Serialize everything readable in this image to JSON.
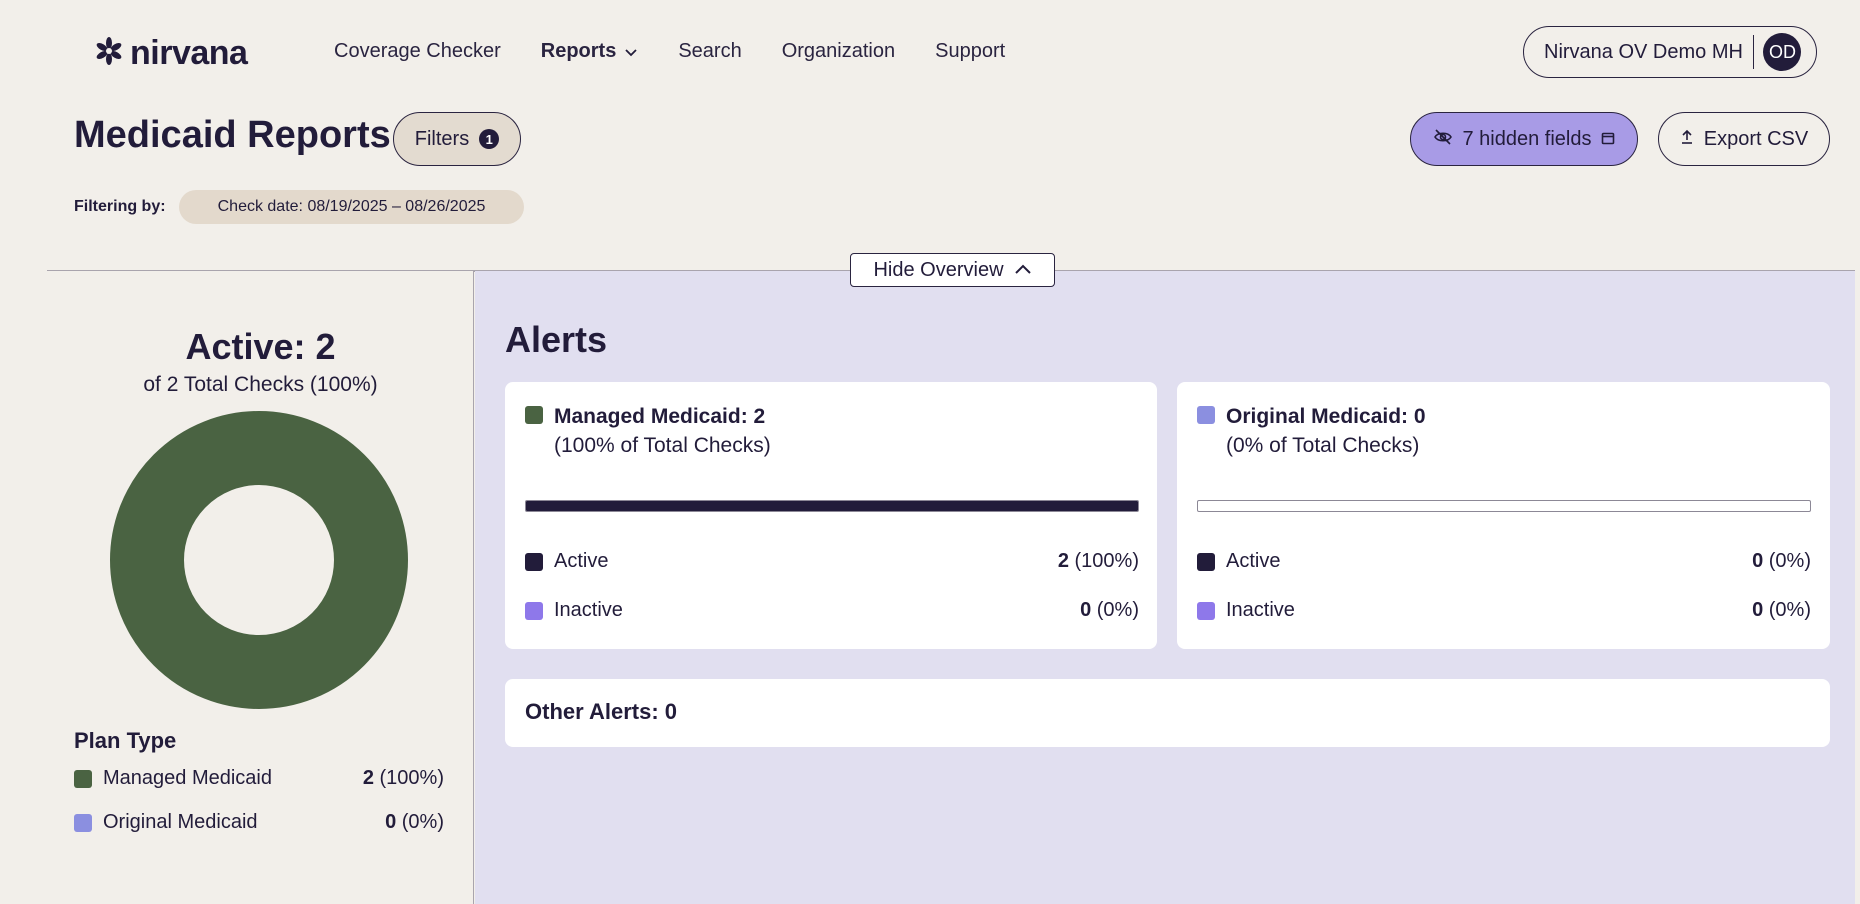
{
  "nav": {
    "logo_text": "nirvana",
    "links": [
      {
        "label": "Coverage Checker"
      },
      {
        "label": "Reports"
      },
      {
        "label": "Search"
      },
      {
        "label": "Organization"
      },
      {
        "label": "Support"
      }
    ],
    "user_name": "Nirvana OV Demo MH",
    "avatar_initials": "OD"
  },
  "header": {
    "title": "Medicaid Reports",
    "filters_label": "Filters",
    "filters_count": "1",
    "hidden_fields_label": "7 hidden fields",
    "export_label": "Export CSV",
    "filtering_by_label": "Filtering by:",
    "filter_chip": "Check date: 08/19/2025 – 08/26/2025",
    "hide_overview_label": "Hide Overview"
  },
  "overview": {
    "active_title": "Active: 2",
    "active_subtitle": "of 2 Total Checks (100%)",
    "plan_type_title": "Plan Type",
    "plan_types": [
      {
        "label": "Managed Medicaid",
        "count": "2",
        "pct": "(100%)",
        "color": "#4a6342",
        "value": 2
      },
      {
        "label": "Original Medicaid",
        "count": "0",
        "pct": "(0%)",
        "color": "#8b8fe0",
        "value": 0
      }
    ]
  },
  "alerts": {
    "title": "Alerts",
    "cards": [
      {
        "title": "Managed Medicaid: 2",
        "subtitle": "(100% of Total Checks)",
        "color": "#4a6342",
        "progress": 1.0,
        "rows": [
          {
            "label": "Active",
            "count": "2",
            "pct": "(100%)",
            "color": "#221c3a"
          },
          {
            "label": "Inactive",
            "count": "0",
            "pct": "(0%)",
            "color": "#8e78ea"
          }
        ]
      },
      {
        "title": "Original Medicaid: 0",
        "subtitle": "(0% of Total Checks)",
        "color": "#8b8fe0",
        "progress": 0.0,
        "rows": [
          {
            "label": "Active",
            "count": "0",
            "pct": "(0%)",
            "color": "#221c3a"
          },
          {
            "label": "Inactive",
            "count": "0",
            "pct": "(0%)",
            "color": "#8e78ea"
          }
        ]
      }
    ],
    "other_label": "Other Alerts: 0"
  }
}
